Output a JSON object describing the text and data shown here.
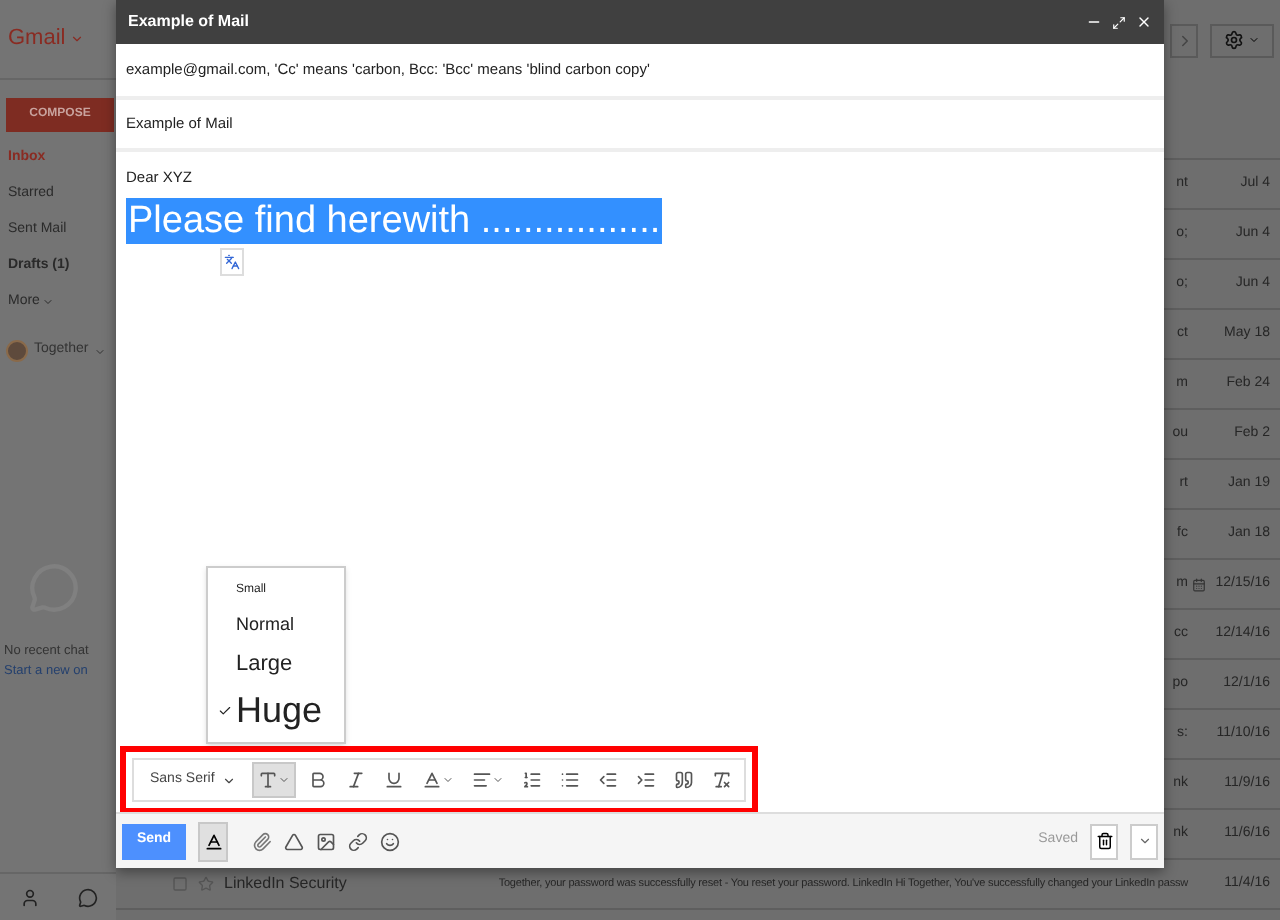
{
  "sidebar": {
    "logo": "Gmail",
    "compose_button": "COMPOSE",
    "items": [
      {
        "kind": "folder",
        "label": "Inbox",
        "selected": true,
        "bold": false
      },
      {
        "kind": "folder",
        "label": "Starred",
        "selected": false,
        "bold": false
      },
      {
        "kind": "folder",
        "label": "Sent Mail",
        "selected": false,
        "bold": false
      },
      {
        "kind": "folder",
        "label": "Drafts (1)",
        "selected": false,
        "bold": true
      },
      {
        "kind": "menu",
        "label": "More",
        "selected": false,
        "bold": false
      }
    ],
    "account": "Together",
    "chat_empty": "No recent chat",
    "chat_link": "Start a new on"
  },
  "mail_list": {
    "rows": [
      {
        "kind": "mail",
        "snippet": "nt",
        "date": "Jul 4"
      },
      {
        "kind": "mail",
        "snippet": "o;",
        "date": "Jun 4"
      },
      {
        "kind": "mail",
        "snippet": "o;",
        "date": "Jun 4"
      },
      {
        "kind": "mail",
        "snippet": "ct",
        "date": "May 18"
      },
      {
        "kind": "mail",
        "snippet": "m",
        "date": "Feb 24"
      },
      {
        "kind": "mail",
        "snippet": "ou",
        "date": "Feb 2"
      },
      {
        "kind": "mail",
        "snippet": "rt",
        "date": "Jan 19"
      },
      {
        "kind": "mail",
        "snippet": "fc",
        "date": "Jan 18"
      },
      {
        "kind": "invite",
        "snippet": "m",
        "date": "12/15/16"
      },
      {
        "kind": "mail",
        "snippet": "cc",
        "date": "12/14/16"
      },
      {
        "kind": "mail",
        "snippet": "po",
        "date": "12/1/16"
      },
      {
        "kind": "mail",
        "snippet": "s:",
        "date": "11/10/16"
      },
      {
        "kind": "mail",
        "snippet": "nk",
        "date": "11/9/16"
      },
      {
        "kind": "mail",
        "snippet": "nk",
        "date": "11/6/16"
      },
      {
        "kind": "mail",
        "sender": "LinkedIn Security",
        "snippet": "Together, your password was successfully reset - You reset your password. LinkedIn Hi Together, You've successfully changed your LinkedIn passw",
        "date": "11/4/16"
      }
    ]
  },
  "compose": {
    "title": "Example of Mail",
    "to": "example@gmail.com, 'Cc' means 'carbon, Bcc: 'Bcc' means 'blind carbon copy'",
    "subject": "Example of Mail",
    "greeting": "Dear XYZ",
    "body": "Please find herewith .................",
    "body_selected": true,
    "size_menu": [
      {
        "kind": "small",
        "label": "Small",
        "selected": false
      },
      {
        "kind": "normal",
        "label": "Normal",
        "selected": false
      },
      {
        "kind": "large",
        "label": "Large",
        "selected": false
      },
      {
        "kind": "huge",
        "label": "Huge",
        "selected": true
      }
    ],
    "toolbar_highlighted": true,
    "tools": [
      {
        "kind": "font",
        "label": "Sans Serif",
        "pressed": false
      },
      {
        "kind": "size",
        "pressed": true
      },
      {
        "kind": "bold",
        "pressed": false
      },
      {
        "kind": "italic",
        "pressed": false
      },
      {
        "kind": "underline",
        "pressed": false
      },
      {
        "kind": "color",
        "pressed": false
      },
      {
        "kind": "align",
        "pressed": false
      },
      {
        "kind": "numbered",
        "pressed": false
      },
      {
        "kind": "bulleted",
        "pressed": false
      },
      {
        "kind": "outdent",
        "pressed": false
      },
      {
        "kind": "indent",
        "pressed": false
      },
      {
        "kind": "quote",
        "pressed": false
      },
      {
        "kind": "clear",
        "pressed": false
      }
    ],
    "send_button": "Send",
    "formatting_on": true,
    "status": "Saved"
  }
}
